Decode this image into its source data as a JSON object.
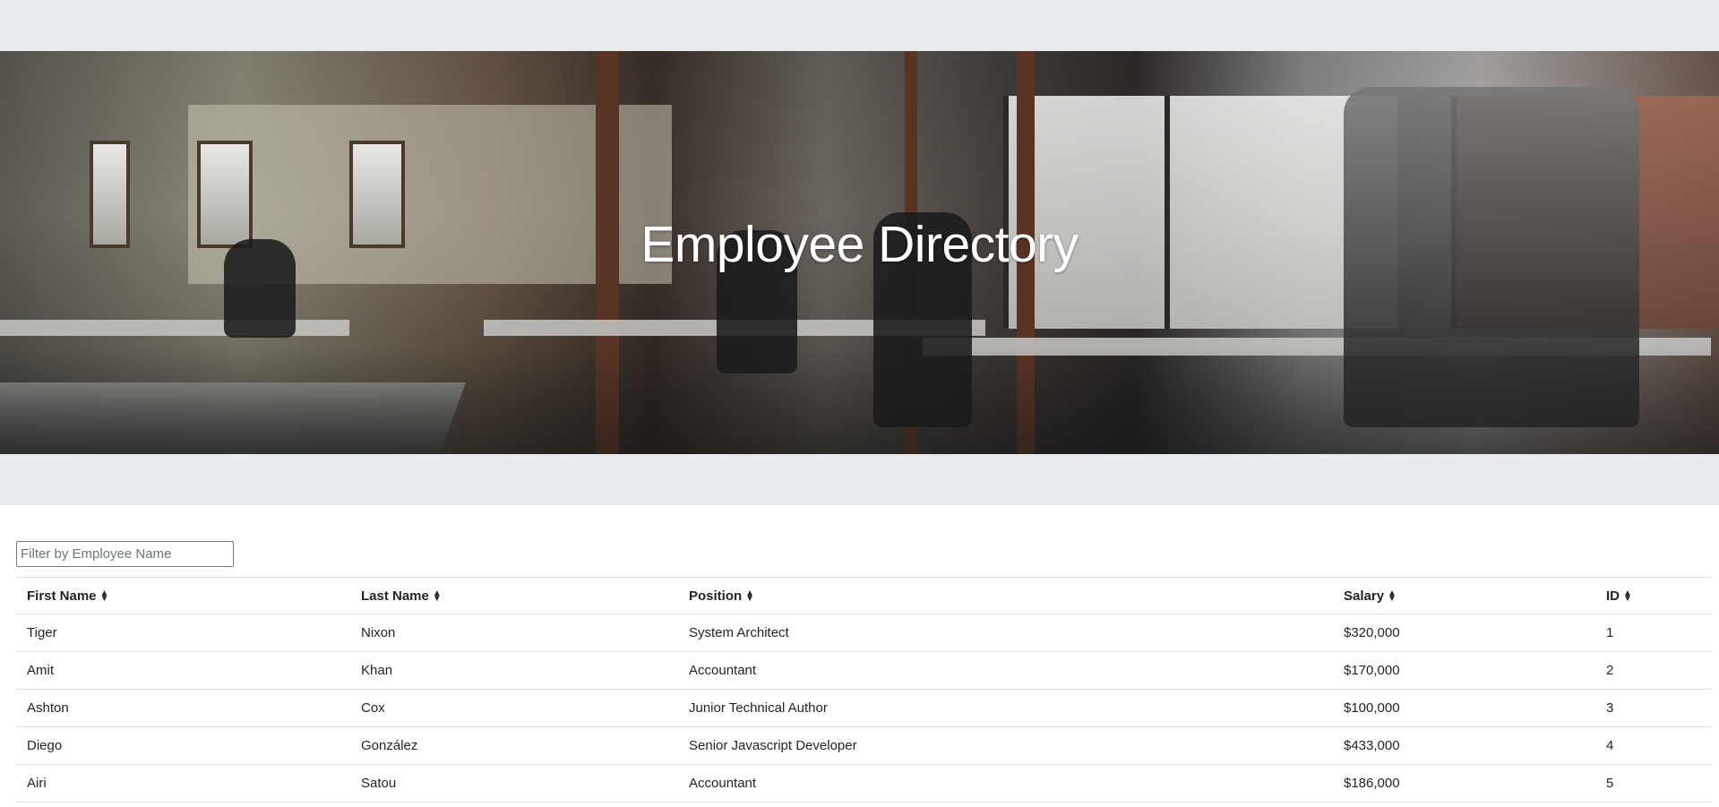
{
  "hero": {
    "title": "Employee Directory"
  },
  "filter": {
    "placeholder": "Filter by Employee Name",
    "value": ""
  },
  "table": {
    "columns": [
      "First Name",
      "Last Name",
      "Position",
      "Salary",
      "ID"
    ],
    "sort_icon": "sort-icon",
    "rows": [
      [
        "Tiger",
        "Nixon",
        "System Architect",
        "$320,000",
        "1"
      ],
      [
        "Amit",
        "Khan",
        "Accountant",
        "$170,000",
        "2"
      ],
      [
        "Ashton",
        "Cox",
        "Junior Technical Author",
        "$100,000",
        "3"
      ],
      [
        "Diego",
        "González",
        "Senior Javascript Developer",
        "$433,000",
        "4"
      ],
      [
        "Airi",
        "Satou",
        "Accountant",
        "$186,000",
        "5"
      ]
    ]
  },
  "colors": {
    "band_background": "#e9ecef",
    "title_color": "#ffffff",
    "text_color": "#212529",
    "border_color": "#dee2e6"
  }
}
